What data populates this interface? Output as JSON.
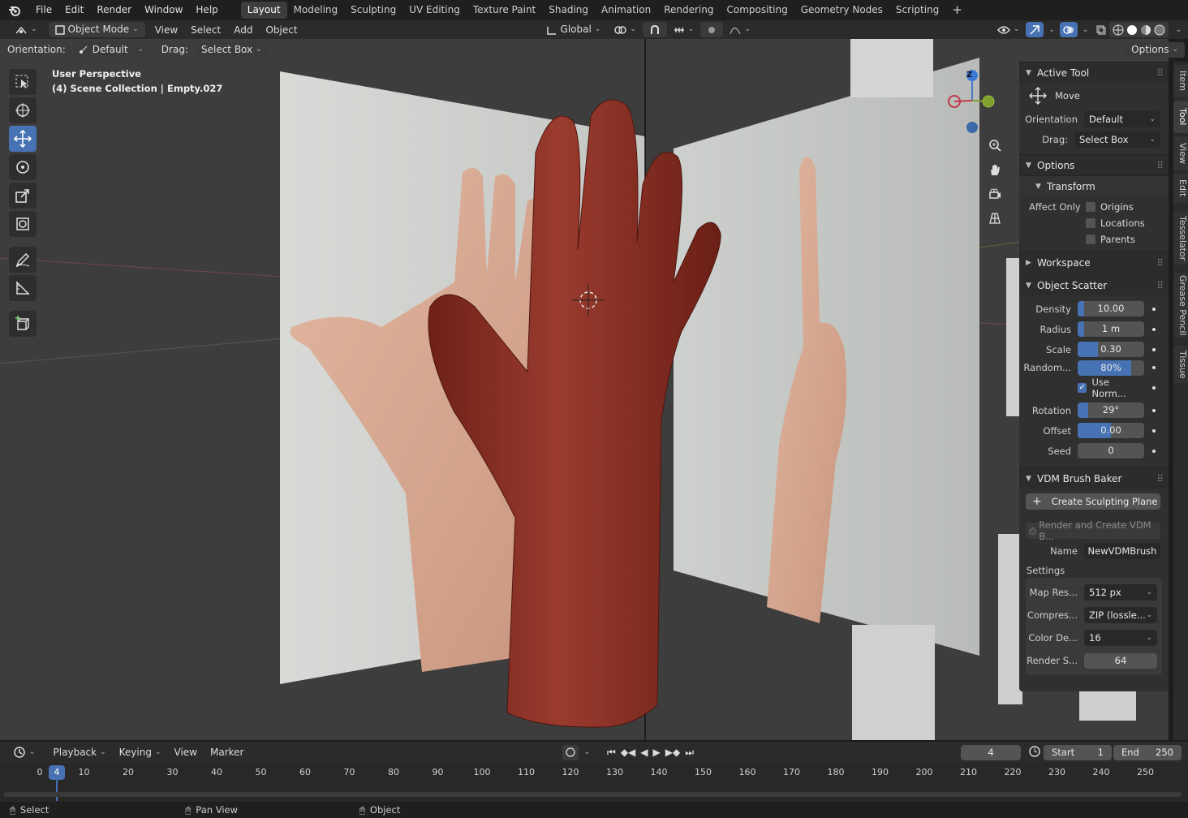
{
  "topbar": {
    "menus": [
      "File",
      "Edit",
      "Render",
      "Window",
      "Help"
    ],
    "workspaces": [
      "Layout",
      "Modeling",
      "Sculpting",
      "UV Editing",
      "Texture Paint",
      "Shading",
      "Animation",
      "Rendering",
      "Compositing",
      "Geometry Nodes",
      "Scripting"
    ],
    "active_workspace": "Layout",
    "add_tab": "+"
  },
  "header": {
    "mode": "Object Mode",
    "menus": [
      "View",
      "Select",
      "Add",
      "Object"
    ],
    "transform_orientation": "Global"
  },
  "tool_settings": {
    "orientation_label": "Orientation:",
    "orientation_value": "Default",
    "drag_label": "Drag:",
    "drag_value": "Select Box",
    "options": "Options"
  },
  "viewport": {
    "perspective": "User Perspective",
    "collection": "(4) Scene Collection | Empty.027",
    "gizmo_axis": "Z"
  },
  "npanel": {
    "active_tool": {
      "title": "Active Tool",
      "tool_name": "Move",
      "orientation_label": "Orientation",
      "orientation_value": "Default",
      "drag_label": "Drag:",
      "drag_value": "Select Box"
    },
    "options": {
      "title": "Options",
      "transform_title": "Transform",
      "affect_only_label": "Affect Only",
      "checkboxes": [
        "Origins",
        "Locations",
        "Parents"
      ]
    },
    "workspace": {
      "title": "Workspace"
    },
    "object_scatter": {
      "title": "Object Scatter",
      "density_label": "Density",
      "density_value": "10.00",
      "density_fill": 0.1,
      "radius_label": "Radius",
      "radius_value": "1 m",
      "radius_fill": 0.1,
      "scale_label": "Scale",
      "scale_value": "0.30",
      "scale_fill": 0.3,
      "random_label": "Random...",
      "random_value": "80%",
      "random_fill": 0.8,
      "use_normal_label": "Use Norm...",
      "rotation_label": "Rotation",
      "rotation_value": "29°",
      "rotation_fill": 0.16,
      "offset_label": "Offset",
      "offset_value": "0.00",
      "offset_fill": 0.5,
      "seed_label": "Seed",
      "seed_value": "0"
    },
    "vdm": {
      "title": "VDM Brush Baker",
      "create_button": "Create Sculpting Plane",
      "render_button": "Render and Create VDM B...",
      "name_label": "Name",
      "name_value": "NewVDMBrush",
      "settings_label": "Settings",
      "map_res_label": "Map Res...",
      "map_res_value": "512 px",
      "compress_label": "Compres...",
      "compress_value": "ZIP (lossle...",
      "color_depth_label": "Color De...",
      "color_depth_value": "16",
      "render_samples_label": "Render S...",
      "render_samples_value": "64"
    }
  },
  "sidetabs": [
    "Item",
    "Tool",
    "View",
    "Edit",
    "Tesselator",
    "Grease Pencil",
    "Tissue"
  ],
  "timeline": {
    "menus": [
      "Playback",
      "Keying",
      "View",
      "Marker"
    ],
    "current_frame": "4",
    "start_label": "Start",
    "start_value": "1",
    "end_label": "End",
    "end_value": "250",
    "ticks": [
      "0",
      "10",
      "20",
      "30",
      "40",
      "50",
      "60",
      "70",
      "80",
      "90",
      "100",
      "110",
      "120",
      "130",
      "140",
      "150",
      "160",
      "170",
      "180",
      "190",
      "200",
      "210",
      "220",
      "230",
      "240",
      "250"
    ]
  },
  "status": {
    "select": "Select",
    "pan": "Pan View",
    "object": "Object"
  },
  "colors": {
    "accent": "#4772b3",
    "viewport_bg": "#3d3d3d",
    "hand": "#8a3328"
  }
}
